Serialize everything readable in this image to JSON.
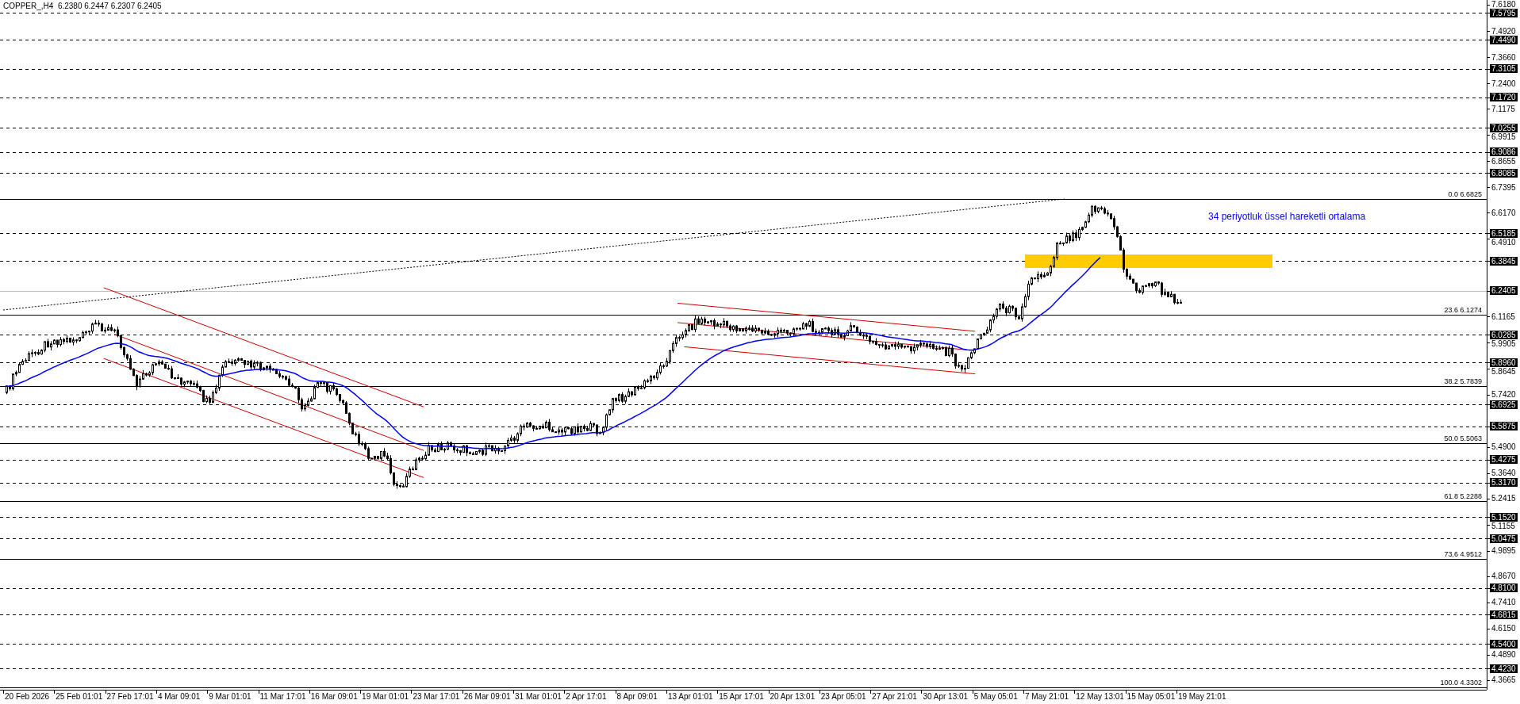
{
  "title": "COPPER_,H4  6.2380 6.2447 6.2307 6.2405",
  "annotation": "34 periyotluk üssel hareketli ortalama",
  "price_axis": [
    {
      "label": "7.6180",
      "kind": "tick"
    },
    {
      "label": "7.5795",
      "kind": "level"
    },
    {
      "label": "7.4920",
      "kind": "tick"
    },
    {
      "label": "7.4490",
      "kind": "level"
    },
    {
      "label": "7.3660",
      "kind": "tick"
    },
    {
      "label": "7.3105",
      "kind": "level"
    },
    {
      "label": "7.2400",
      "kind": "tick"
    },
    {
      "label": "7.1720",
      "kind": "level"
    },
    {
      "label": "7.1175",
      "kind": "tick"
    },
    {
      "label": "7.0255",
      "kind": "level"
    },
    {
      "label": "6.9915",
      "kind": "tick"
    },
    {
      "label": "6.9086",
      "kind": "level"
    },
    {
      "label": "6.8655",
      "kind": "tick"
    },
    {
      "label": "6.8085",
      "kind": "level"
    },
    {
      "label": "6.7395",
      "kind": "tick"
    },
    {
      "label": "6.6170",
      "kind": "tick"
    },
    {
      "label": "6.5185",
      "kind": "level"
    },
    {
      "label": "6.4910",
      "kind": "tick"
    },
    {
      "label": "6.3845",
      "kind": "level"
    },
    {
      "label": "6.2405",
      "kind": "current"
    },
    {
      "label": "6.1165",
      "kind": "tick"
    },
    {
      "label": "6.0285",
      "kind": "level"
    },
    {
      "label": "5.9905",
      "kind": "tick"
    },
    {
      "label": "5.8960",
      "kind": "level"
    },
    {
      "label": "5.8645",
      "kind": "tick"
    },
    {
      "label": "5.7420",
      "kind": "tick"
    },
    {
      "label": "5.6925",
      "kind": "level"
    },
    {
      "label": "5.5875",
      "kind": "level"
    },
    {
      "label": "5.4900",
      "kind": "tick"
    },
    {
      "label": "5.4275",
      "kind": "level"
    },
    {
      "label": "5.3640",
      "kind": "tick"
    },
    {
      "label": "5.3170",
      "kind": "level"
    },
    {
      "label": "5.2415",
      "kind": "tick"
    },
    {
      "label": "5.1520",
      "kind": "level"
    },
    {
      "label": "5.1155",
      "kind": "tick"
    },
    {
      "label": "5.0475",
      "kind": "level"
    },
    {
      "label": "4.9895",
      "kind": "tick"
    },
    {
      "label": "4.8670",
      "kind": "tick"
    },
    {
      "label": "4.8100",
      "kind": "level"
    },
    {
      "label": "4.7410",
      "kind": "tick"
    },
    {
      "label": "4.6815",
      "kind": "level"
    },
    {
      "label": "4.6150",
      "kind": "tick"
    },
    {
      "label": "4.5400",
      "kind": "level"
    },
    {
      "label": "4.4890",
      "kind": "tick"
    },
    {
      "label": "4.4230",
      "kind": "level"
    },
    {
      "label": "4.3665",
      "kind": "tick"
    }
  ],
  "fibonacci": [
    {
      "label": "0.0 6.6825"
    },
    {
      "label": "23.6 6.1274"
    },
    {
      "label": "38.2 5.7839"
    },
    {
      "label": "50.0 5.5063"
    },
    {
      "label": "61.8 5.2288"
    },
    {
      "label": "73,6 4.9512"
    },
    {
      "label": "100.0 4.3302"
    }
  ],
  "time_axis": [
    "20 Feb 2026",
    "25 Feb 01:01",
    "27 Feb 17:01",
    "4 Mar 09:01",
    "9 Mar 01:01",
    "11 Mar 17:01",
    "16 Mar 09:01",
    "19 Mar 01:01",
    "23 Mar 17:01",
    "26 Mar 09:01",
    "31 Mar 01:01",
    "2 Apr 17:01",
    "8 Apr 09:01",
    "13 Apr 01:01",
    "15 Apr 17:01",
    "20 Apr 13:01",
    "23 Apr 05:01",
    "27 Apr 21:01",
    "30 Apr 13:01",
    "5 May 05:01",
    "7 May 21:01",
    "12 May 13:01",
    "15 May 05:01",
    "19 May 21:01"
  ]
}
